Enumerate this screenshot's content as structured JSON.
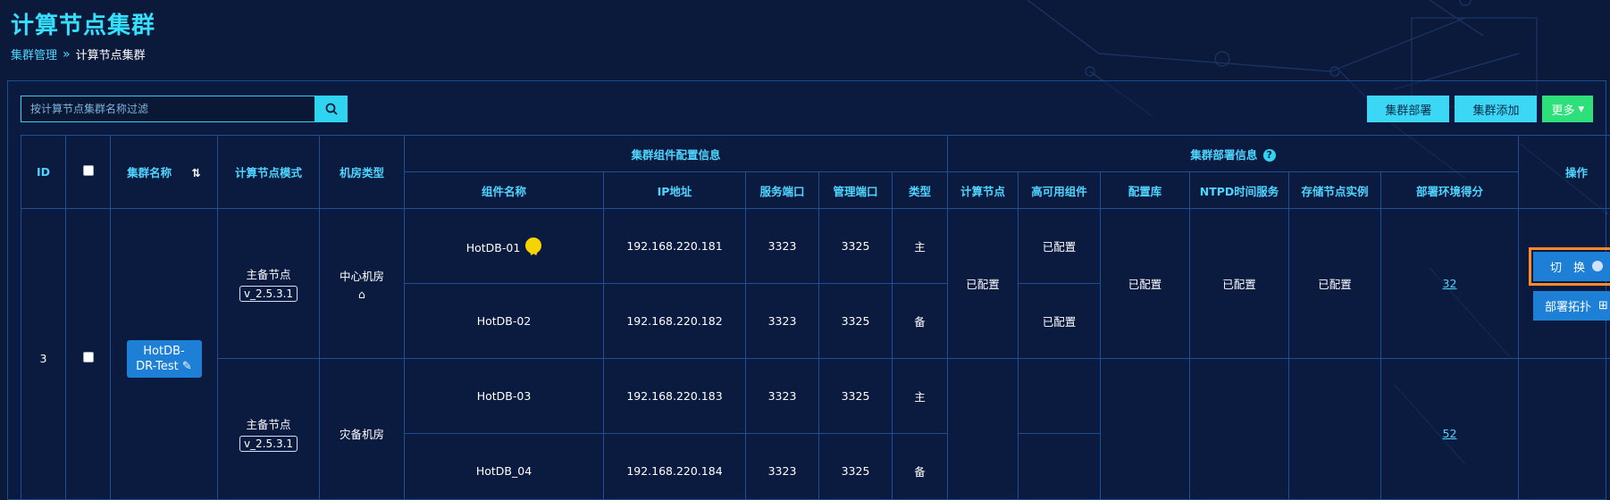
{
  "page": {
    "title": "计算节点集群"
  },
  "breadcrumb": {
    "parent": "集群管理",
    "separator": "»",
    "current": "计算节点集群"
  },
  "search": {
    "placeholder": "按计算节点集群名称过滤"
  },
  "toolbar": {
    "deploy": "集群部署",
    "add": "集群添加",
    "more": "更多"
  },
  "table": {
    "headers": {
      "id": "ID",
      "name": "集群名称",
      "mode": "计算节点模式",
      "room_type": "机房类型",
      "component_group": "集群组件配置信息",
      "deploy_group": "集群部署信息",
      "operation": "操作",
      "comp_name": "组件名称",
      "ip": "IP地址",
      "service_port": "服务端口",
      "manage_port": "管理端口",
      "type": "类型",
      "compute_node": "计算节点",
      "ha_component": "高可用组件",
      "config_db": "配置库",
      "ntpd": "NTPD时间服务",
      "storage_instance": "存储节点实例",
      "env_score": "部署环境得分"
    },
    "row": {
      "id": "3",
      "cluster_name": "HotDB-DR-Test",
      "groups": [
        {
          "mode": "主备节点",
          "version": "v_2.5.3.1",
          "room": "中心机房",
          "score": "32",
          "components": [
            {
              "name": "HotDB-01",
              "ip": "192.168.220.181",
              "service_port": "3323",
              "manage_port": "3325",
              "type": "主",
              "ha": "已配置"
            },
            {
              "name": "HotDB-02",
              "ip": "192.168.220.182",
              "service_port": "3323",
              "manage_port": "3325",
              "type": "备",
              "ha": "已配置"
            }
          ]
        },
        {
          "mode": "主备节点",
          "version": "v_2.5.3.1",
          "room": "灾备机房",
          "score": "52",
          "components": [
            {
              "name": "HotDB-03",
              "ip": "192.168.220.183",
              "service_port": "3323",
              "manage_port": "3325",
              "type": "主"
            },
            {
              "name": "HotDB_04",
              "ip": "192.168.220.184",
              "service_port": "3323",
              "manage_port": "3325",
              "type": "备"
            }
          ]
        }
      ],
      "compute_node_status": "已配置",
      "config_db_status": "已配置",
      "ntpd_status": "已配置",
      "storage_status": "已配置"
    },
    "actions": {
      "switch": "切　换",
      "topology": "部署拓扑"
    }
  },
  "colors": {
    "accent": "#35e0ff",
    "green": "#3ee27c",
    "highlight": "#ff8a2c",
    "bg": "#0b1a3a"
  }
}
